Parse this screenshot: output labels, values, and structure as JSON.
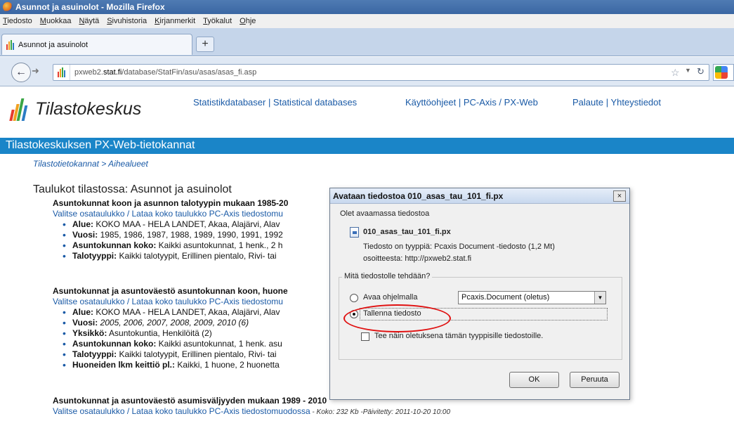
{
  "browser": {
    "window_title": "Asunnot ja asuinolot - Mozilla Firefox",
    "menu": [
      "Tiedosto",
      "Muokkaa",
      "Näytä",
      "Sivuhistoria",
      "Kirjanmerkit",
      "Työkalut",
      "Ohje"
    ],
    "tab_title": "Asunnot ja asuinolot",
    "new_tab": "+",
    "url_prefix": "pxweb2.",
    "url_domain": "stat.fi",
    "url_path": "/database/StatFin/asu/asas/asas_fi.asp",
    "icons": [
      "firefox-logo-icon",
      "back-arrow-icon",
      "forward-arrow-icon",
      "bookmark-star-icon",
      "reload-icon",
      "search-engine-icon"
    ]
  },
  "site": {
    "logo_text": "Tilastokeskus",
    "nav1": "Statistikdatabaser | Statistical databases",
    "nav2": "Käyttöohjeet | PC-Axis / PX-Web",
    "nav3": "Palaute | Yhteystiedot",
    "band_title": "Tilastokeskuksen PX-Web-tietokannat",
    "breadcrumb": "Tilastotietokannat > Aihealueet",
    "page_title": "Taulukot tilastossa: Asunnot ja asuinolot"
  },
  "tables": [
    {
      "heading": "Asuntokunnat koon ja asunnon talotyypin mukaan 1985-20",
      "links": "Valitse osataulukko / Lataa koko taulukko PC-Axis tiedostomu",
      "items": [
        {
          "label": "Alue:",
          "value": " KOKO MAA - HELA LANDET, Akaa, Alajärvi, Alav"
        },
        {
          "label": "Vuosi:",
          "value": " 1985, 1986, 1987, 1988, 1989, 1990, 1991, 1992"
        },
        {
          "label": "Asuntokunnan koko:",
          "value": " Kaikki asuntokunnat, 1 henk., 2 h"
        },
        {
          "label": "Talotyyppi:",
          "value": " Kaikki talotyypit, Erillinen pientalo, Rivi- tai"
        }
      ]
    },
    {
      "heading": "Asuntokunnat ja asuntoväestö asuntokunnan koon, huone",
      "links": "Valitse osataulukko / Lataa koko taulukko PC-Axis tiedostomu",
      "items": [
        {
          "label": "Alue:",
          "value": " KOKO MAA - HELA LANDET, Akaa, Alajärvi, Alav"
        },
        {
          "label": "Vuosi:",
          "value": " 2005, 2006, 2007, 2008, 2009, 2010 (6)"
        },
        {
          "label": "Yksikkö:",
          "value": " Asuntokuntia, Henkilöitä (2)"
        },
        {
          "label": "Asuntokunnan koko:",
          "value": " Kaikki asuntokunnat, 1 henk. asu"
        },
        {
          "label": "Talotyyppi:",
          "value": " Kaikki talotyypit, Erillinen pientalo, Rivi- tai"
        },
        {
          "label": "Huoneiden lkm keittiö pl.:",
          "value": " Kaikki, 1 huone, 2 huonetta"
        }
      ]
    },
    {
      "heading": "Asuntokunnat ja asuntoväestö asumisväljyyden mukaan 1989 - 2010",
      "links": "Valitse osataulukko / Lataa koko taulukko PC-Axis tiedostomuodossa",
      "meta": " - Koko: 232 Kb -Päivitetty: 2011-10-20 10:00",
      "items": []
    }
  ],
  "dialog": {
    "title": "Avataan tiedostoa 010_asas_tau_101_fi.px",
    "close": "×",
    "intro": "Olet avaamassa tiedostoa",
    "filename": "010_asas_tau_101_fi.px",
    "type_line": "Tiedosto on tyyppiä:  Pcaxis Document -tiedosto (1,2 Mt)",
    "from_line": "osoitteesta: http://pxweb2.stat.fi",
    "question": "Mitä tiedostolle tehdään?",
    "open_with_label": "Avaa ohjelmalla",
    "open_with_value": "Pcaxis.Document (oletus)",
    "save_label": "Tallenna tiedosto",
    "save_selected": true,
    "remember_label": "Tee näin oletuksena tämän tyyppisille tiedostoille.",
    "ok": "OK",
    "cancel": "Peruuta",
    "highlight_color": "#e01010"
  }
}
